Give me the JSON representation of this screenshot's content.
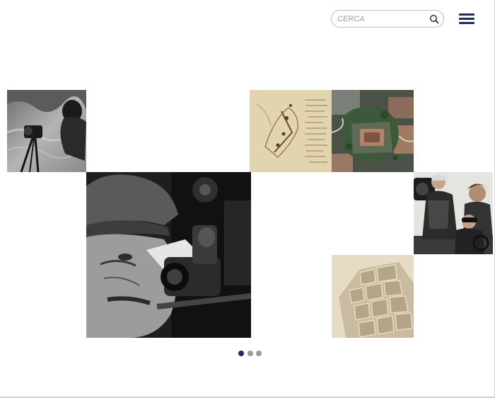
{
  "header": {
    "search": {
      "placeholder": "CERCA",
      "value": ""
    },
    "icons": {
      "search": "search-icon",
      "menu": "hamburger-menu-icon"
    },
    "brand_color": "#1f2c5c"
  },
  "carousel": {
    "slide_count": 3,
    "active_index": 0,
    "tiles": [
      {
        "name": "photo-camera-operator-underwater",
        "kind": "bw-photo"
      },
      {
        "name": "photo-man-with-film-camera",
        "kind": "bw-photo"
      },
      {
        "name": "historic-manuscript-map",
        "kind": "sepia-document"
      },
      {
        "name": "aerial-city-photo",
        "kind": "color-photo"
      },
      {
        "name": "photo-film-crew",
        "kind": "color-photo"
      },
      {
        "name": "historic-city-plan",
        "kind": "sepia-map"
      }
    ]
  }
}
